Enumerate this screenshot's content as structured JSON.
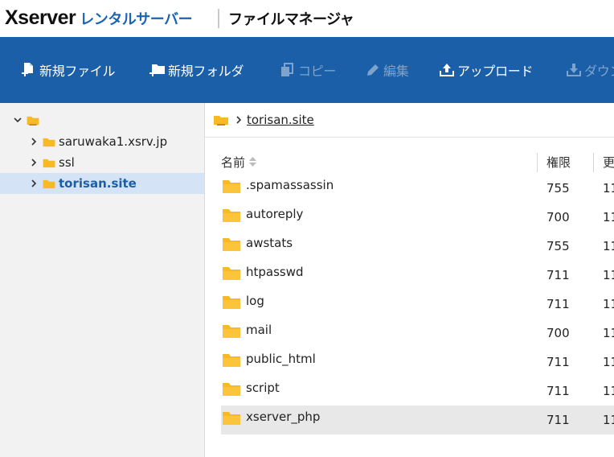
{
  "header": {
    "logo_main": "Xserver",
    "logo_sub": "レンタルサーバー",
    "app_title": "ファイルマネージャ"
  },
  "toolbar": {
    "new_file": "新規ファイル",
    "new_folder": "新規フォルダ",
    "copy": "コピー",
    "edit": "編集",
    "upload": "アップロード",
    "download": "ダウン"
  },
  "tree": {
    "items": [
      {
        "label": "saruwaka1.xsrv.jp"
      },
      {
        "label": "ssl"
      },
      {
        "label": "torisan.site"
      }
    ]
  },
  "breadcrumb": {
    "current": "torisan.site"
  },
  "table": {
    "columns": {
      "name": "名前",
      "permission": "権限",
      "updated": "更"
    },
    "rows": [
      {
        "name": ".spamassassin",
        "perm": "755",
        "updated": "11"
      },
      {
        "name": "autoreply",
        "perm": "700",
        "updated": "11"
      },
      {
        "name": "awstats",
        "perm": "755",
        "updated": "11"
      },
      {
        "name": "htpasswd",
        "perm": "711",
        "updated": "11"
      },
      {
        "name": "log",
        "perm": "711",
        "updated": "11"
      },
      {
        "name": "mail",
        "perm": "700",
        "updated": "11"
      },
      {
        "name": "public_html",
        "perm": "711",
        "updated": "11"
      },
      {
        "name": "script",
        "perm": "711",
        "updated": "11"
      },
      {
        "name": "xserver_php",
        "perm": "711",
        "updated": "11"
      }
    ]
  },
  "colors": {
    "toolbar_bg": "#1a5fa8",
    "brand_blue": "#1a64b0",
    "folder_yellow": "#f7b924",
    "selected_bg": "#d4e3f6",
    "row_highlight": "#e8e8e8"
  }
}
